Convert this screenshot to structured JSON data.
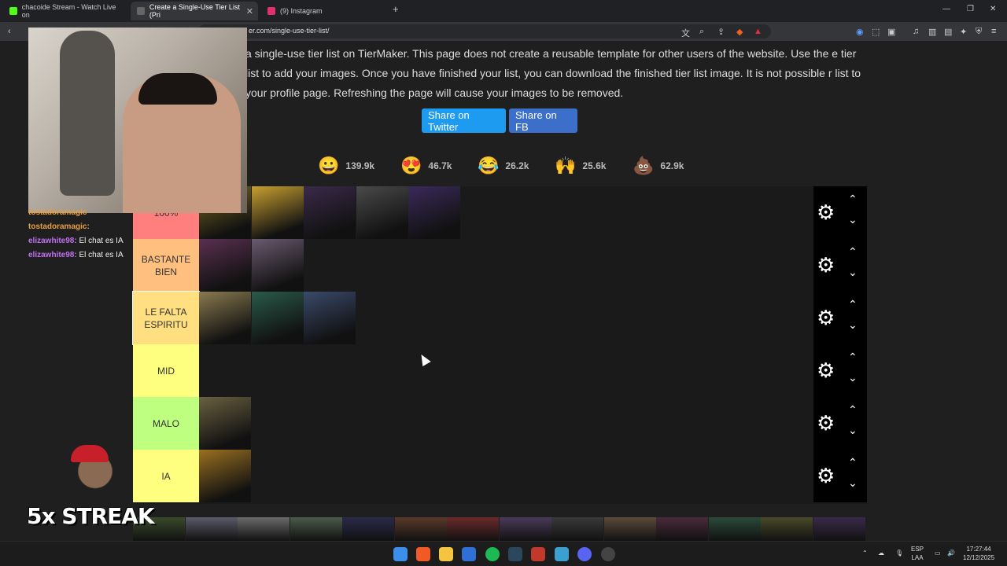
{
  "browser": {
    "tabs": [
      {
        "label": "chacoide Stream - Watch Live on",
        "color": "#53fc18"
      },
      {
        "label": "Create a Single-Use Tier List (Pri",
        "color": "#444"
      },
      {
        "label": "(9) Instagram",
        "color": "#e1306c"
      }
    ],
    "url": "er.com/single-use-tier-list/"
  },
  "page": {
    "description": "a single-use tier list on TierMaker. This page does not create a reusable template for other users of the website. Use the e tier list to add your images. Once you have finished your list, you can download the finished tier list image. It is not possible r list to your profile page. Refreshing the page will cause your images to be removed.",
    "share_twitter": "Share on Twitter",
    "share_fb": "Share on FB",
    "reactions": [
      {
        "emoji": "😀",
        "count": "139.9k"
      },
      {
        "emoji": "😍",
        "count": "46.7k"
      },
      {
        "emoji": "😂",
        "count": "26.2k"
      },
      {
        "emoji": "🙌",
        "count": "25.6k"
      },
      {
        "emoji": "💩",
        "count": "62.9k"
      }
    ]
  },
  "tiers": [
    {
      "label": "100%",
      "color": "#ff7f7f",
      "thumbs": [
        "#7a6a20",
        "#c9a030",
        "#3a2a4a",
        "#4a4a4a",
        "#3a2a5a"
      ]
    },
    {
      "label": "BASTANTE BIEN",
      "color": "#ffbf7f",
      "thumbs": [
        "#5a3050",
        "#6a5a70"
      ]
    },
    {
      "label": "LE FALTA ESPIRITU",
      "color": "#ffdf7f",
      "thumbs": [
        "#8a7a50",
        "#2a5a4a",
        "#3a4a6a"
      ]
    },
    {
      "label": "MID",
      "color": "#ffff7f",
      "thumbs": []
    },
    {
      "label": "MALO",
      "color": "#bfff7f",
      "thumbs": [
        "#6a6040"
      ]
    },
    {
      "label": "IA",
      "color": "#ffff7f",
      "thumbs": [
        "#9a7020"
      ]
    }
  ],
  "chat": [
    {
      "user": "tostadoramagic:",
      "msg": "",
      "color": "#e8a040"
    },
    {
      "user": "elizawhite98:",
      "msg": "El chat es IA",
      "color": "#c070f0"
    },
    {
      "user": "elizawhite98:",
      "msg": "El chat es IA",
      "color": "#c070f0"
    }
  ],
  "chat_top_user": "tostadoramagic",
  "streak": "5x STREAK",
  "taskbar": {
    "lang": "ESP",
    "lang2": "LAA",
    "time": "17:27:44",
    "date": "12/12/2025"
  }
}
